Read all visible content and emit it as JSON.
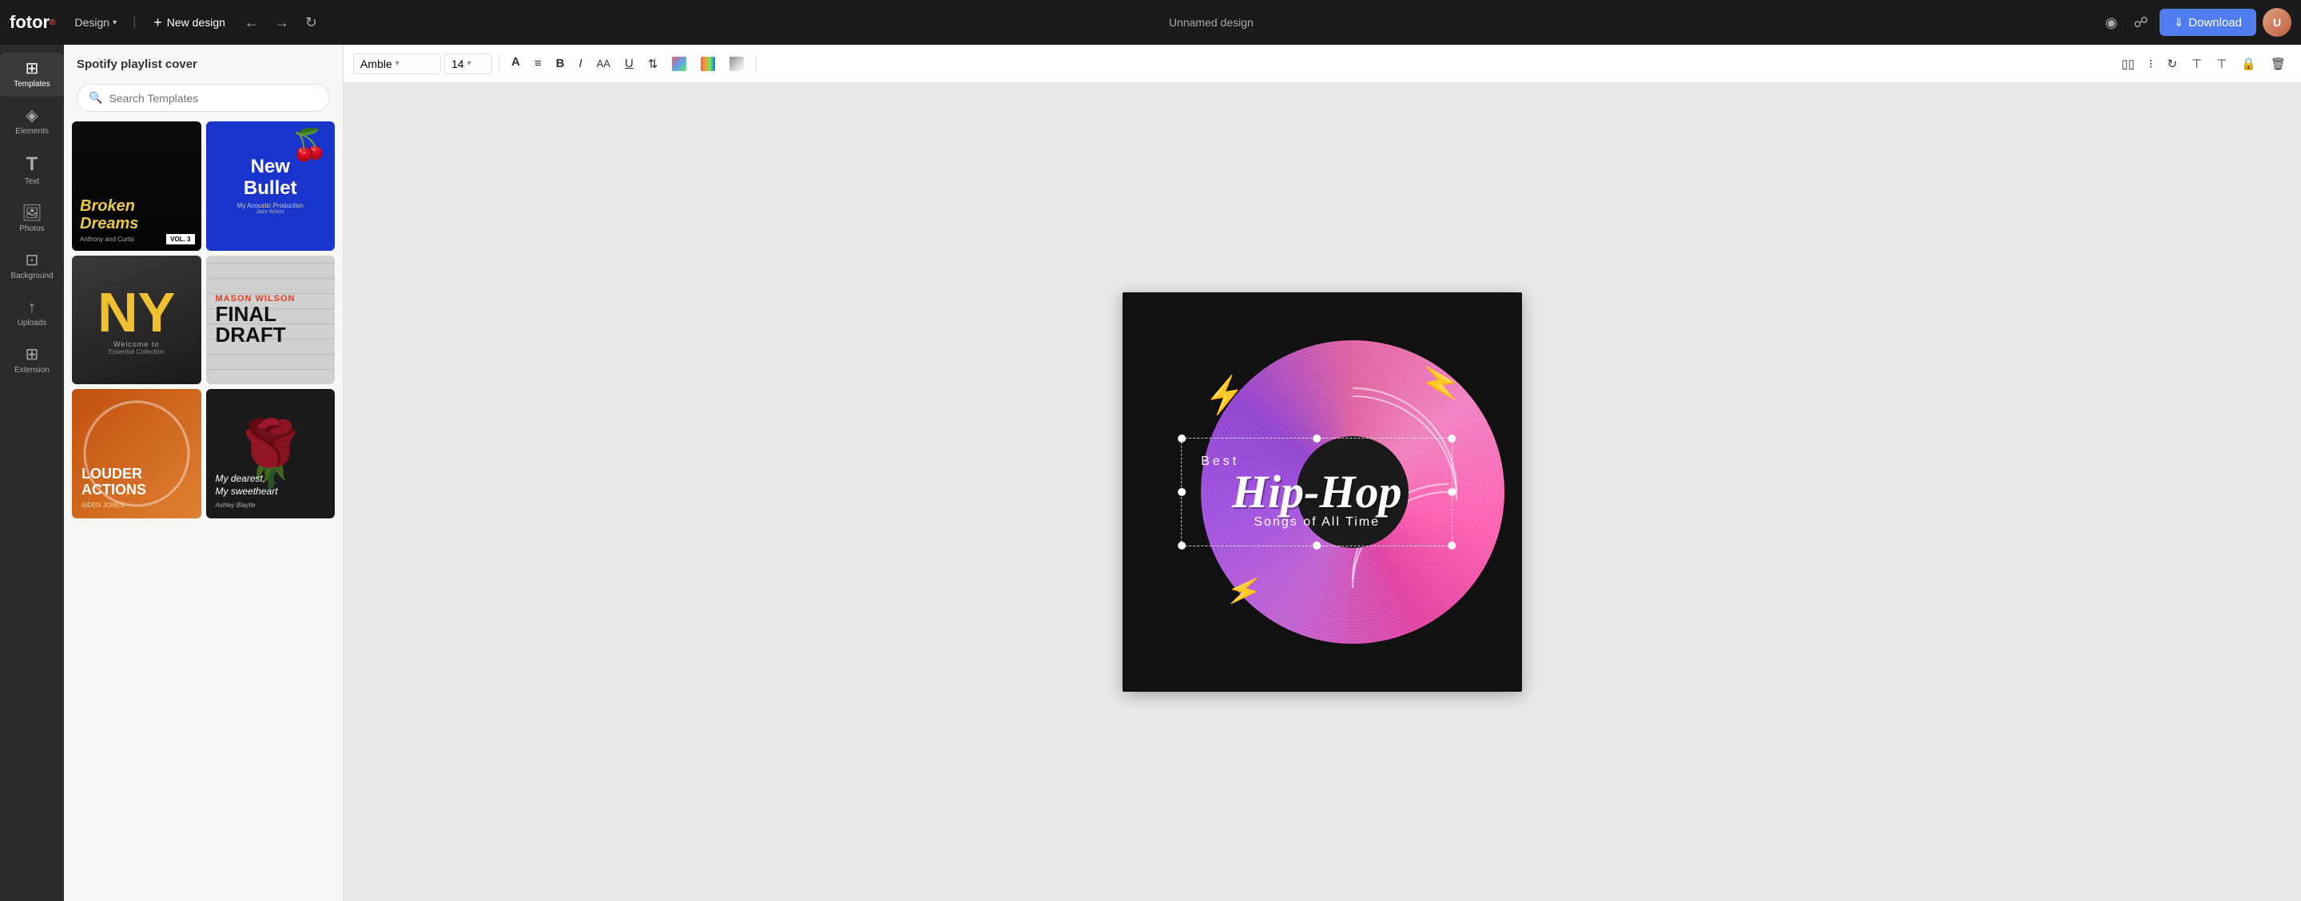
{
  "app": {
    "logo": "fotor",
    "logo_superscript": "®"
  },
  "top_nav": {
    "design_label": "Design",
    "new_design_label": "New design",
    "doc_title": "Unnamed design",
    "download_label": "Download",
    "undo_icon": "undo",
    "redo_icon": "redo",
    "history_icon": "history",
    "share_icon": "share",
    "preview_icon": "preview"
  },
  "toolbar": {
    "font_family": "Amble",
    "font_size": "14",
    "align_icon": "align",
    "bold_icon": "bold",
    "italic_icon": "italic",
    "letter_spacing_icon": "letter-spacing",
    "underline_icon": "underline",
    "line_height_icon": "line-height",
    "text_color_icon": "text-color",
    "highlight_icon": "highlight",
    "shadow_icon": "shadow"
  },
  "sidebar": {
    "items": [
      {
        "id": "templates",
        "label": "Templates",
        "icon": "⊞",
        "active": true
      },
      {
        "id": "elements",
        "label": "Elements",
        "icon": "◈",
        "active": false
      },
      {
        "id": "text",
        "label": "Text",
        "icon": "T",
        "active": false
      },
      {
        "id": "photos",
        "label": "Photos",
        "icon": "⊟",
        "active": false
      },
      {
        "id": "background",
        "label": "Background",
        "icon": "⊡",
        "active": false
      },
      {
        "id": "uploads",
        "label": "Uploads",
        "icon": "↑",
        "active": false
      },
      {
        "id": "extension",
        "label": "Extension",
        "icon": "⊞",
        "active": false
      }
    ]
  },
  "panel": {
    "title": "Spotify playlist cover",
    "search_placeholder": "Search Templates",
    "templates": [
      {
        "id": "broken-dreams",
        "name": "Broken Dreams",
        "type": "dark-text"
      },
      {
        "id": "new-bullet",
        "name": "New Bullet",
        "type": "blue-cherries"
      },
      {
        "id": "ny",
        "name": "NY",
        "type": "yellow-letter"
      },
      {
        "id": "final-draft",
        "name": "Final Draft",
        "type": "gray-red"
      },
      {
        "id": "louder-actions",
        "name": "Louder Actions",
        "type": "orange-gradient"
      },
      {
        "id": "sweetheart",
        "name": "Sweetheart",
        "type": "dark-rose"
      }
    ]
  },
  "canvas": {
    "design_title": "Best Hip-Hop Songs of All Time",
    "design_text_line1": "Best",
    "design_text_line2": "Hip-Hop",
    "design_text_line3": "Songs of All Time"
  }
}
